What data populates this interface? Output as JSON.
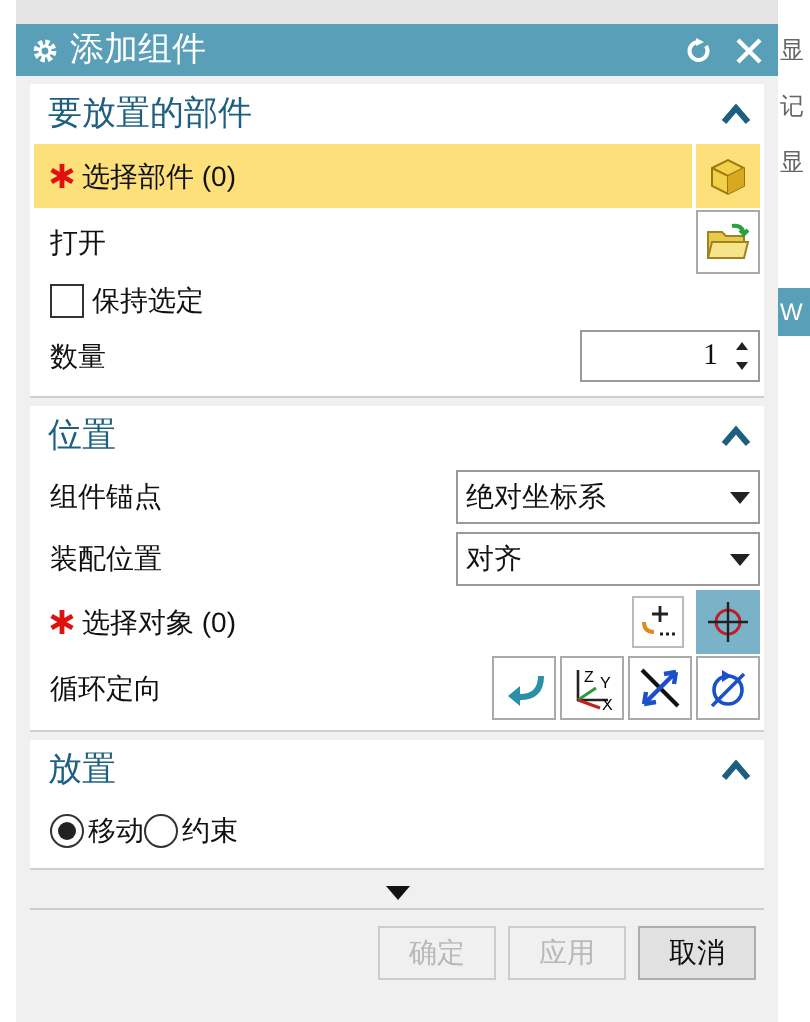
{
  "background": {
    "right_texts": [
      "显",
      "记",
      "显"
    ],
    "right_tab": "W"
  },
  "window": {
    "title": "添加组件"
  },
  "sections": [
    {
      "title": "要放置的部件",
      "expanded": true,
      "rows": [
        {
          "kind": "selection",
          "label": "选择部件 (0)",
          "required": true,
          "active": true
        },
        {
          "kind": "button_row",
          "label": "打开"
        },
        {
          "kind": "checkbox",
          "label": "保持选定",
          "checked": false
        },
        {
          "kind": "spinner",
          "label": "数量",
          "value": "1"
        }
      ]
    },
    {
      "title": "位置",
      "expanded": true,
      "rows": [
        {
          "kind": "dropdown",
          "label": "组件锚点",
          "value": "绝对坐标系"
        },
        {
          "kind": "dropdown",
          "label": "装配位置",
          "value": "对齐"
        },
        {
          "kind": "selection",
          "label": "选择对象 (0)",
          "required": true,
          "active": false
        },
        {
          "kind": "icons",
          "label": "循环定向",
          "axis_labels": [
            "Z",
            "Y",
            "X"
          ]
        }
      ]
    },
    {
      "title": "放置",
      "expanded": true,
      "rows": [
        {
          "kind": "radios",
          "options": [
            {
              "label": "移动",
              "selected": true
            },
            {
              "label": "约束",
              "selected": false
            }
          ]
        }
      ]
    }
  ],
  "buttons": [
    {
      "label": "确定",
      "disabled": true
    },
    {
      "label": "应用",
      "disabled": true
    },
    {
      "label": "取消",
      "disabled": false
    }
  ]
}
